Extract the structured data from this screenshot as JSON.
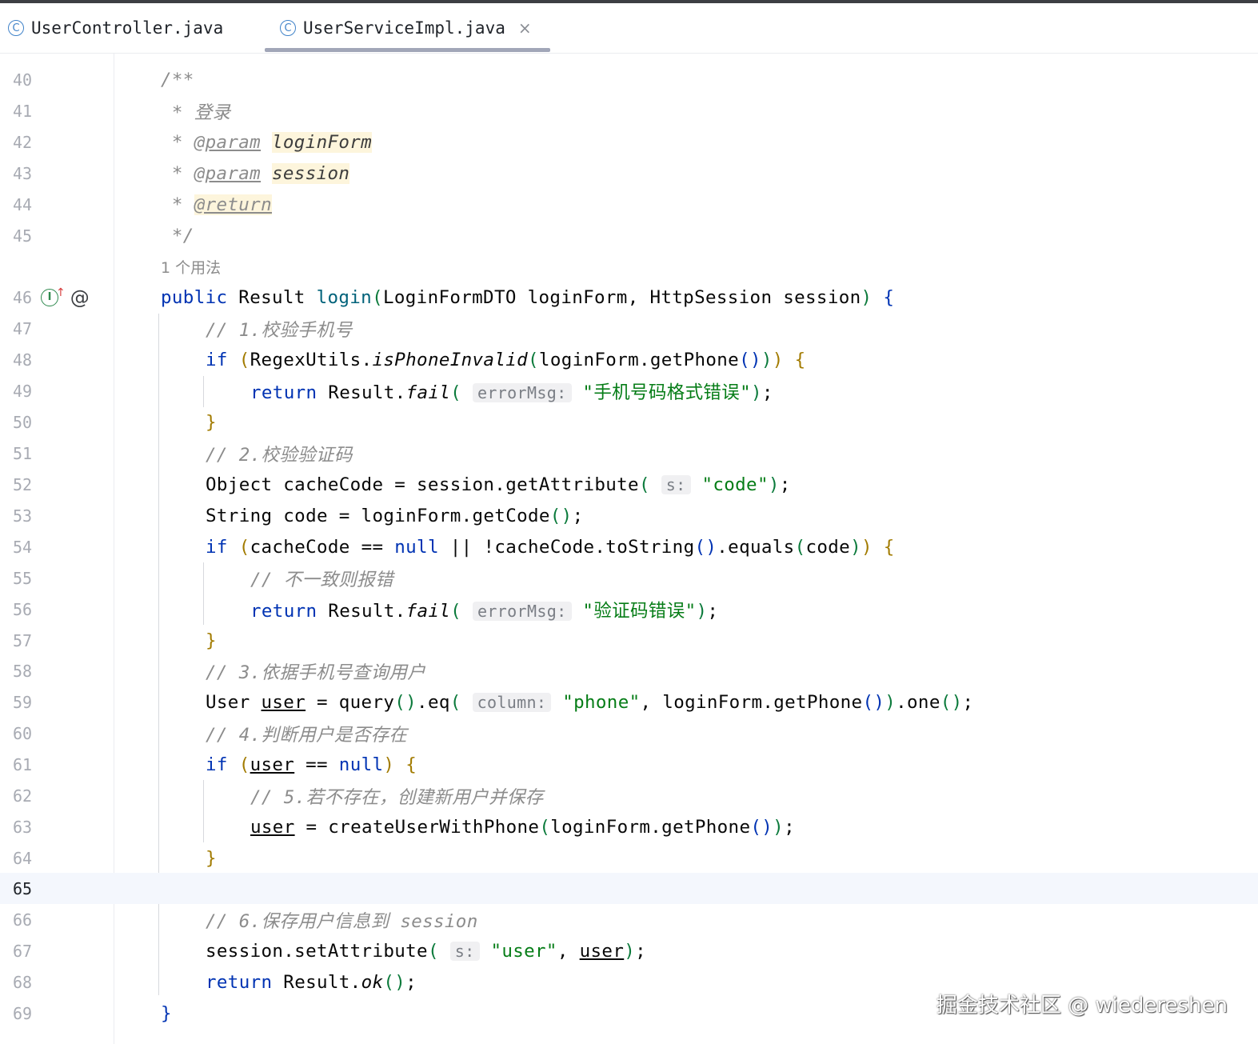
{
  "tabs": [
    {
      "label": "UserController.java",
      "active": false
    },
    {
      "label": "UserServiceImpl.java",
      "active": true
    }
  ],
  "usage_hint": "1 个用法",
  "current_line": 65,
  "watermark": "掘金技术社区 @ wiedereshen",
  "lines": [
    {
      "n": "40",
      "text": "/**"
    },
    {
      "n": "41",
      "text": " * 登录"
    },
    {
      "n": "42",
      "text": " * @param loginForm"
    },
    {
      "n": "43",
      "text": " * @param session"
    },
    {
      "n": "44",
      "text": " * @return"
    },
    {
      "n": "45",
      "text": " */"
    },
    {
      "n": "46",
      "text": "public Result login(LoginFormDTO loginForm, HttpSession session) {"
    },
    {
      "n": "47",
      "text": "// 1.校验手机号"
    },
    {
      "n": "48",
      "text": "if (RegexUtils.isPhoneInvalid(loginForm.getPhone())) {"
    },
    {
      "n": "49",
      "text": "return Result.fail( errorMsg: \"手机号码格式错误\");"
    },
    {
      "n": "50",
      "text": "}"
    },
    {
      "n": "51",
      "text": "// 2.校验验证码"
    },
    {
      "n": "52",
      "text": "Object cacheCode = session.getAttribute( s: \"code\");"
    },
    {
      "n": "53",
      "text": "String code = loginForm.getCode();"
    },
    {
      "n": "54",
      "text": "if (cacheCode == null || !cacheCode.toString().equals(code)) {"
    },
    {
      "n": "55",
      "text": "// 不一致则报错"
    },
    {
      "n": "56",
      "text": "return Result.fail( errorMsg: \"验证码错误\");"
    },
    {
      "n": "57",
      "text": "}"
    },
    {
      "n": "58",
      "text": "// 3.依据手机号查询用户"
    },
    {
      "n": "59",
      "text": "User user = query().eq( column: \"phone\", loginForm.getPhone()).one();"
    },
    {
      "n": "60",
      "text": "// 4.判断用户是否存在"
    },
    {
      "n": "61",
      "text": "if (user == null) {"
    },
    {
      "n": "62",
      "text": "// 5.若不存在，创建新用户并保存"
    },
    {
      "n": "63",
      "text": "user = createUserWithPhone(loginForm.getPhone());"
    },
    {
      "n": "64",
      "text": "}"
    },
    {
      "n": "65",
      "text": ""
    },
    {
      "n": "66",
      "text": "// 6.保存用户信息到 session"
    },
    {
      "n": "67",
      "text": "session.setAttribute( s: \"user\", user);"
    },
    {
      "n": "68",
      "text": "return Result.ok();"
    },
    {
      "n": "69",
      "text": "}"
    }
  ],
  "tokens": {
    "l41_comment": "登录",
    "l42_tag": "@param",
    "l42_name": "loginForm",
    "l43_tag": "@param",
    "l43_name": "session",
    "l44_tag": "@return",
    "l46_kw": "public",
    "l46_type": "Result",
    "l46_fn": "login",
    "l46_params": "LoginFormDTO loginForm, HttpSession session",
    "l47_comment": "// 1.校验手机号",
    "l48_kw": "if",
    "l48_cls": "RegexUtils.",
    "l48_m": "isPhoneInvalid",
    "l48_arg": "loginForm.getPhone",
    "l49_kw": "return",
    "l49_cls": "Result.",
    "l49_m": "fail",
    "l49_hint": "errorMsg:",
    "l49_str": "\"手机号码格式错误\"",
    "l51_comment": "// 2.校验验证码",
    "l52_pre": "Object cacheCode = session.getAttribute",
    "l52_hint": "s:",
    "l52_str": "\"code\"",
    "l53_pre": "String code = loginForm.getCode",
    "l54_kw": "if",
    "l54_a": "cacheCode == ",
    "l54_null": "null",
    "l54_b": " || !cacheCode.toString",
    "l54_c": ".equals",
    "l54_d": "code",
    "l55_comment": "// 不一致则报错",
    "l56_kw": "return",
    "l56_cls": "Result.",
    "l56_m": "fail",
    "l56_hint": "errorMsg:",
    "l56_str": "\"验证码错误\"",
    "l58_comment": "// 3.依据手机号查询用户",
    "l59_type": "User ",
    "l59_var": "user",
    "l59_a": " = query",
    "l59_b": ".eq",
    "l59_hint": "column:",
    "l59_str": "\"phone\"",
    "l59_c": ", loginForm.getPhone",
    "l59_d": ".one",
    "l60_comment": "// 4.判断用户是否存在",
    "l61_kw": "if",
    "l61_var": "user",
    "l61_null": "null",
    "l62_comment": "// 5.若不存在，创建新用户并保存",
    "l63_var": "user",
    "l63_a": " = createUserWithPhone",
    "l63_b": "loginForm.getPhone",
    "l66_comment": "// 6.保存用户信息到 session",
    "l67_a": "session.setAttribute",
    "l67_hint": "s:",
    "l67_str": "\"user\"",
    "l67_var": "user",
    "l68_kw": "return",
    "l68_cls": "Result.",
    "l68_m": "ok"
  }
}
